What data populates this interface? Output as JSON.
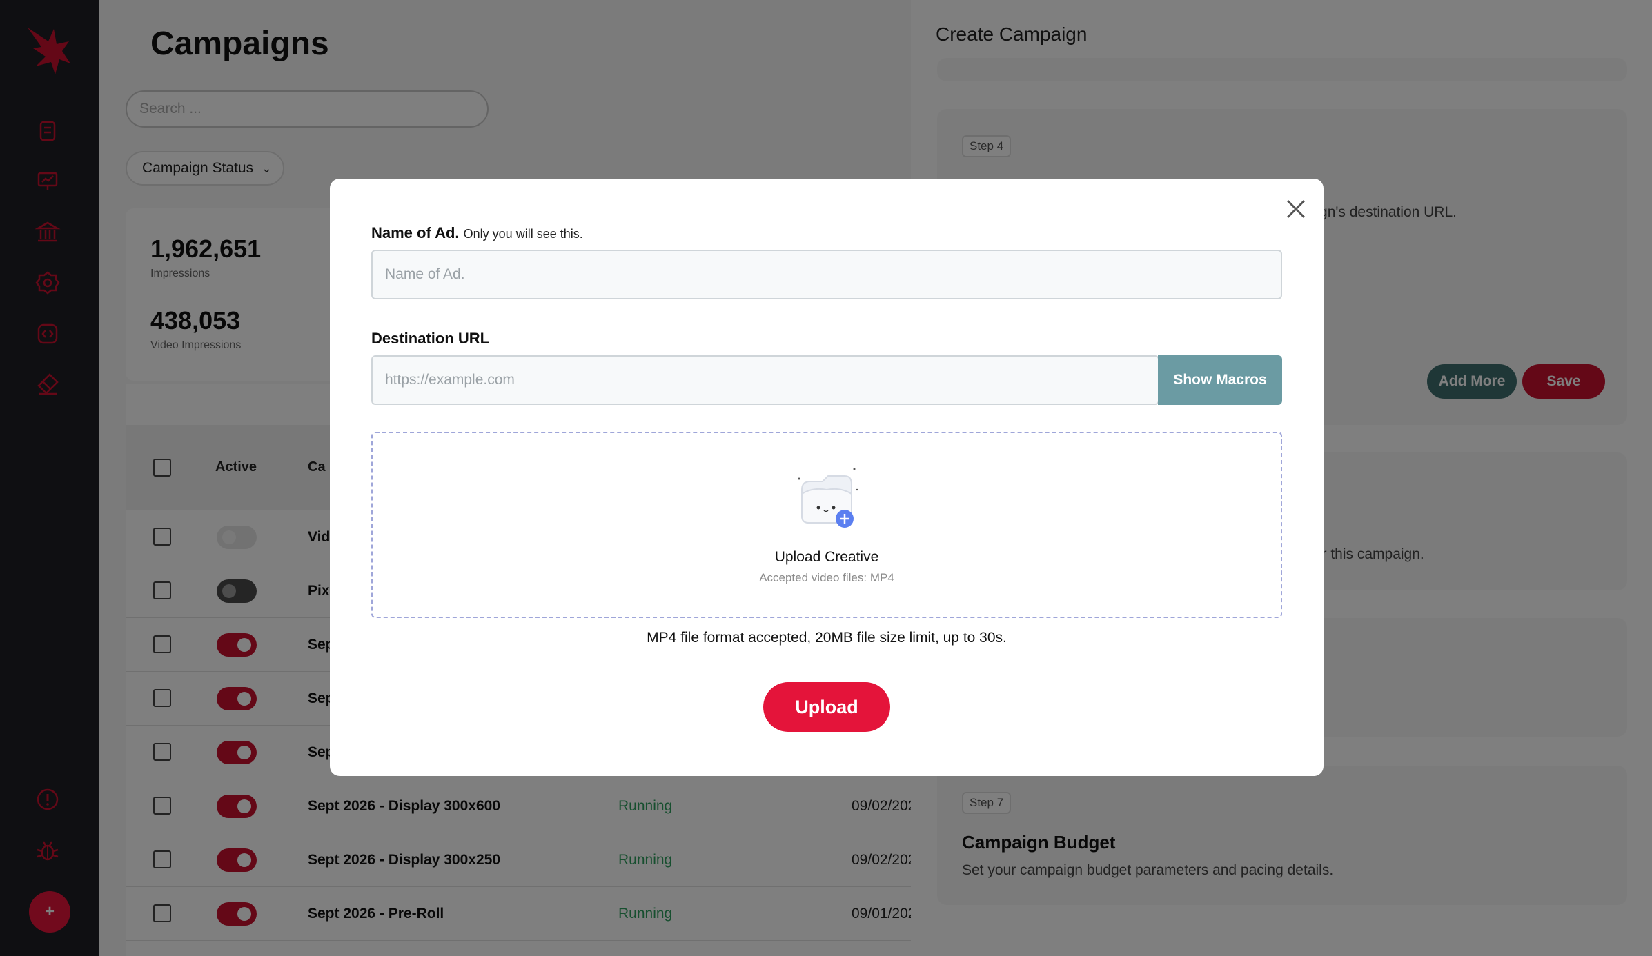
{
  "main": {
    "title": "Campaigns",
    "search_placeholder": "Search ...",
    "status_filter": "Campaign Status",
    "stats": [
      {
        "value": "1,962,651",
        "label": "Impressions"
      },
      {
        "value": "438,053",
        "label": "Video Impressions"
      }
    ],
    "table": {
      "headers": {
        "active": "Active",
        "campaign": "Ca"
      },
      "rows": [
        {
          "name": "Vid",
          "active": "faint",
          "status": "",
          "date": ""
        },
        {
          "name": "Pix",
          "active": "off",
          "status": "",
          "date": ""
        },
        {
          "name": "Sep",
          "active": "on",
          "status": "",
          "date": ""
        },
        {
          "name": "Sep",
          "active": "on",
          "status": "",
          "date": ""
        },
        {
          "name": "Sep",
          "active": "on",
          "status": "",
          "date": ""
        },
        {
          "name": "Sept 2026 - Display 300x600",
          "active": "on",
          "status": "Running",
          "date": "09/02/2026"
        },
        {
          "name": "Sept 2026 - Display 300x250",
          "active": "on",
          "status": "Running",
          "date": "09/02/2026"
        },
        {
          "name": "Sept 2026 - Pre-Roll",
          "active": "on",
          "status": "Running",
          "date": "09/01/2026"
        }
      ]
    }
  },
  "panel": {
    "title": "Create Campaign",
    "step4": {
      "badge": "Step 4",
      "text": "paign's destination URL.",
      "add_more": "Add More",
      "save": "Save"
    },
    "step5": {
      "text": "for this campaign."
    },
    "step7": {
      "badge": "Step 7",
      "title": "Campaign Budget",
      "text": "Set your campaign budget parameters and pacing details."
    }
  },
  "modal": {
    "name_label": "Name of Ad.",
    "name_hint": "Only you will see this.",
    "name_placeholder": "Name of Ad.",
    "url_label": "Destination URL",
    "url_placeholder": "https://example.com",
    "macros_button": "Show Macros",
    "drop_title": "Upload Creative",
    "drop_subtitle": "Accepted video files: MP4",
    "note": "MP4 file format accepted, 20MB file size limit, up to 30s.",
    "upload_button": "Upload"
  },
  "colors": {
    "brand_red": "#e4143a",
    "sidebar": "#1e1f24",
    "macros": "#6b9ba3",
    "running": "#2e9e5e"
  },
  "icons": [
    "logo-eagle-icon",
    "clipboard-icon",
    "presentation-icon",
    "bank-icon",
    "gear-icon",
    "code-icon",
    "eraser-icon",
    "alert-icon",
    "bug-icon",
    "plus-icon",
    "close-icon",
    "folder-upload-icon",
    "chevron-down-icon"
  ]
}
